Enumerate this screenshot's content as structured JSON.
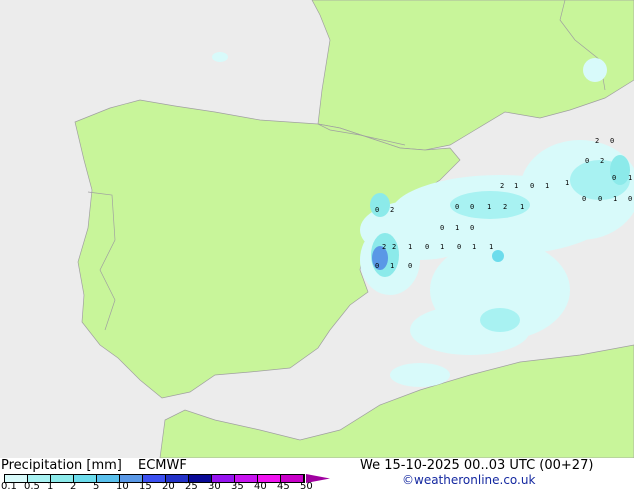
{
  "title": "Precipitation [mm]",
  "model": "ECMWF",
  "datetime": "We 15-10-2025 00..03 UTC (00+27)",
  "credit": "©weatheronline.co.uk",
  "colors": {
    "land": "#c8f59a",
    "sea": "#ececec",
    "border": "#a0a0a0"
  },
  "legend": {
    "ticks": [
      "0.1",
      "0.5",
      "1",
      "2",
      "5",
      "10",
      "15",
      "20",
      "25",
      "30",
      "35",
      "40",
      "45",
      "50"
    ],
    "colors": [
      "#d8fafa",
      "#a8f2f2",
      "#8ceaea",
      "#6cdcec",
      "#5ac0ec",
      "#5a98e6",
      "#3c50f0",
      "#2432c8",
      "#0a0a96",
      "#9614f0",
      "#c814f0",
      "#f014f0",
      "#c800c8"
    ]
  },
  "point_values": [
    "0",
    "2",
    "0",
    "0",
    "1",
    "2",
    "1",
    "2",
    "2",
    "1",
    "0",
    "1",
    "0",
    "1",
    "1",
    "0",
    "1",
    "0",
    "2",
    "1",
    "0",
    "1",
    "1",
    "0",
    "0",
    "1",
    "0",
    "0",
    "1",
    "0",
    "0",
    "2",
    "0",
    "1",
    "2",
    "0"
  ]
}
